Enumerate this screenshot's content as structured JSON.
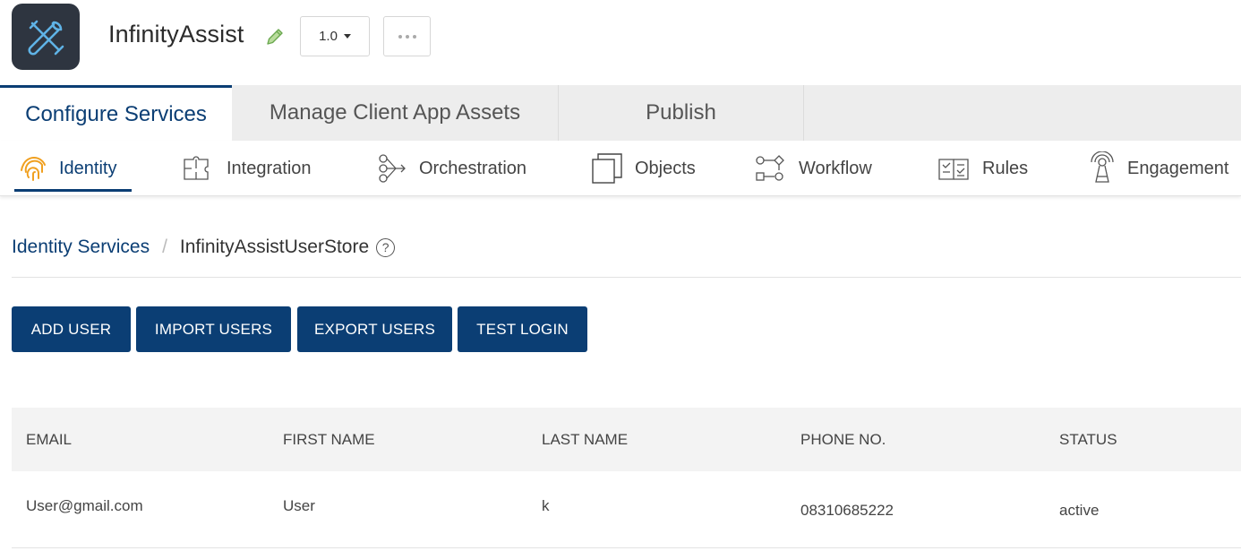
{
  "app": {
    "logo_icon": "tools-icon",
    "title": "InfinityAssist",
    "version": "1.0"
  },
  "top_tabs": [
    {
      "label": "Configure Services",
      "active": true
    },
    {
      "label": "Manage Client App Assets",
      "active": false
    },
    {
      "label": "Publish",
      "active": false
    }
  ],
  "sub_tabs": [
    {
      "label": "Identity",
      "icon": "fingerprint-icon",
      "active": true
    },
    {
      "label": "Integration",
      "icon": "puzzle-icon",
      "active": false
    },
    {
      "label": "Orchestration",
      "icon": "orchestration-icon",
      "active": false
    },
    {
      "label": "Objects",
      "icon": "objects-icon",
      "active": false
    },
    {
      "label": "Workflow",
      "icon": "workflow-icon",
      "active": false
    },
    {
      "label": "Rules",
      "icon": "rules-book-icon",
      "active": false
    },
    {
      "label": "Engagement",
      "icon": "engagement-icon",
      "active": false
    }
  ],
  "breadcrumb": {
    "parent": "Identity Services",
    "current": "InfinityAssistUserStore",
    "help": "?"
  },
  "actions": {
    "add_user": "ADD USER",
    "import_users": "IMPORT USERS",
    "export_users": "EXPORT USERS",
    "test_login": "TEST LOGIN"
  },
  "table": {
    "columns": [
      "EMAIL",
      "FIRST NAME",
      "LAST NAME",
      "PHONE NO.",
      "STATUS"
    ],
    "rows": [
      {
        "email": "User@gmail.com",
        "first_name": "User",
        "last_name": "k",
        "phone": "08310685222",
        "status": "active"
      }
    ]
  },
  "colors": {
    "primary": "#0b3e74",
    "logo_bg": "#2e3540",
    "edit_icon": "#7bb661",
    "fingerprint_icon": "#f0a020"
  }
}
